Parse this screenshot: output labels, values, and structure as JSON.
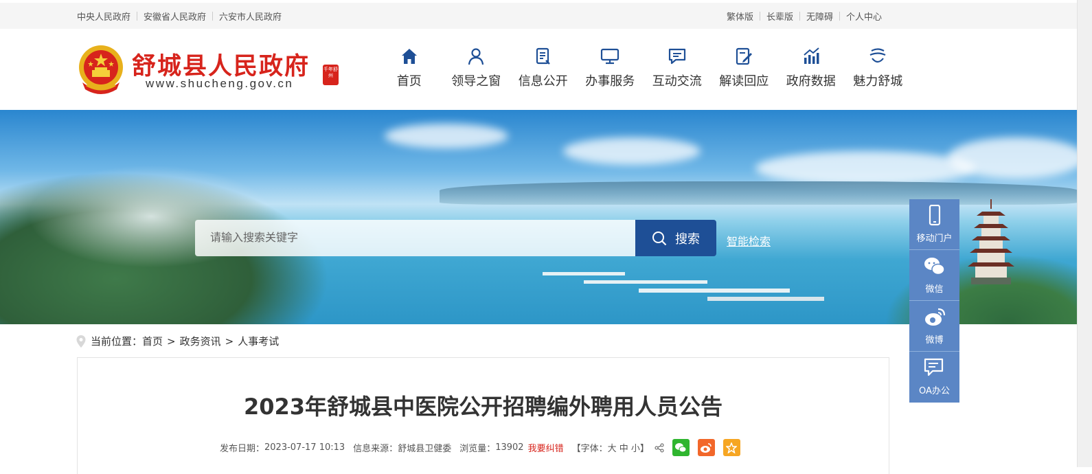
{
  "topbar": {
    "left_links": [
      "中央人民政府",
      "安徽省人民政府",
      "六安市人民政府"
    ],
    "right_links": [
      "繁体版",
      "长辈版",
      "无障碍",
      "个人中心"
    ]
  },
  "header": {
    "site_name": "舒城县人民政府",
    "site_url": "www.shucheng.gov.cn",
    "seal_text": "千年舒州"
  },
  "nav": {
    "items": [
      {
        "label": "首页",
        "icon": "home-icon"
      },
      {
        "label": "领导之窗",
        "icon": "person-icon"
      },
      {
        "label": "信息公开",
        "icon": "document-icon"
      },
      {
        "label": "办事服务",
        "icon": "monitor-icon"
      },
      {
        "label": "互动交流",
        "icon": "chat-icon"
      },
      {
        "label": "解读回应",
        "icon": "edit-icon"
      },
      {
        "label": "政府数据",
        "icon": "chart-icon"
      },
      {
        "label": "魅力舒城",
        "icon": "landscape-icon"
      }
    ]
  },
  "search": {
    "placeholder": "请输入搜索关键字",
    "button_label": "搜索",
    "smart_search": "智能检索"
  },
  "breadcrumb": {
    "prefix": "当前位置：",
    "items": [
      "首页",
      "政务资讯",
      "人事考试"
    ],
    "separator": ">"
  },
  "article": {
    "title": "2023年舒城县中医院公开招聘编外聘用人员公告",
    "publish_label": "发布日期：",
    "publish_date": "2023-07-17 10:13",
    "source_label": "信息来源：",
    "source": "舒城县卫健委",
    "views_label": "浏览量：",
    "views": "13902",
    "report_error": "我要纠错",
    "font_prefix": "【字体：",
    "font_large": "大",
    "font_medium": "中",
    "font_small": "小",
    "font_suffix": "】"
  },
  "side": {
    "items": [
      {
        "label": "移动门户",
        "icon": "phone-icon"
      },
      {
        "label": "微信",
        "icon": "wechat-icon"
      },
      {
        "label": "微博",
        "icon": "weibo-icon"
      },
      {
        "label": "OA办公",
        "icon": "message-icon"
      }
    ]
  },
  "colors": {
    "brand_red": "#d7241c",
    "nav_blue": "#1e4f96",
    "side_blue": "#5b86c5"
  }
}
